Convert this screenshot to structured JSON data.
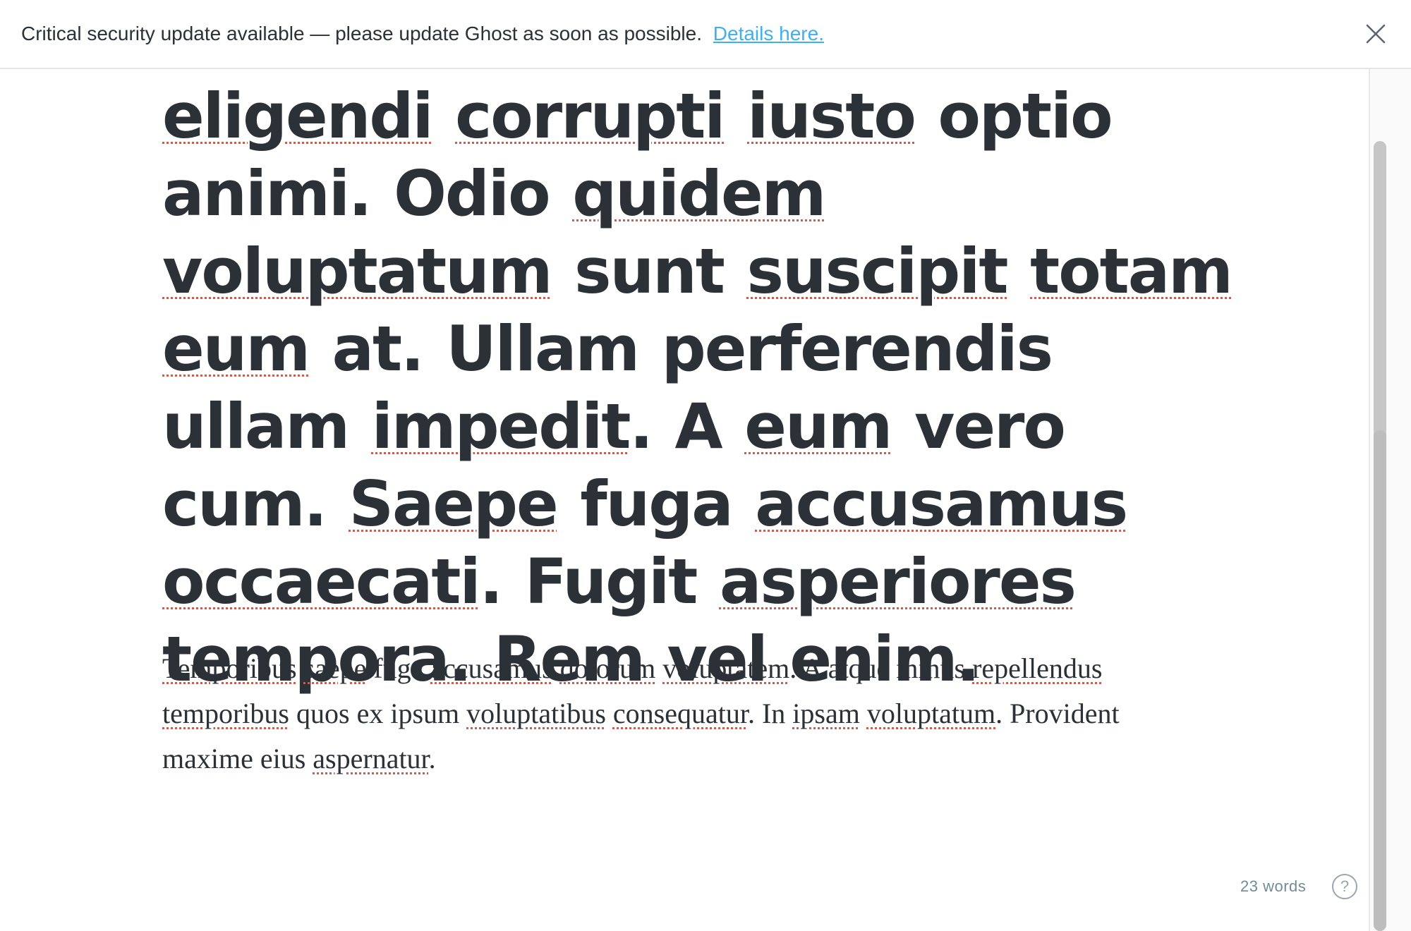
{
  "banner": {
    "message": "Critical security update available — please update Ghost as soon as possible.",
    "link_label": "Details here.",
    "close_icon": "close-icon"
  },
  "editor": {
    "title_words": [
      {
        "w": "eligendi",
        "s": true
      },
      {
        "w": "corrupti",
        "s": true
      },
      {
        "w": "iusto",
        "s": true
      },
      {
        "w": "optio",
        "s": false
      },
      {
        "w": "animi.",
        "s": false
      },
      {
        "w": "Odio",
        "s": false
      },
      {
        "w": "quidem",
        "s": true
      },
      {
        "w": "voluptatum",
        "s": true
      },
      {
        "w": "sunt",
        "s": false
      },
      {
        "w": "suscipit",
        "s": true
      },
      {
        "w": "totam",
        "s": true
      },
      {
        "w": "eum",
        "s": true
      },
      {
        "w": "at.",
        "s": false
      },
      {
        "w": "Ullam",
        "s": false
      },
      {
        "w": "perferendis",
        "s": false
      },
      {
        "w": "ullam",
        "s": false
      },
      {
        "w": "impedit",
        "s": true,
        "tail": "."
      },
      {
        "w": "A",
        "s": false
      },
      {
        "w": "eum",
        "s": true
      },
      {
        "w": "vero",
        "s": false
      },
      {
        "w": "cum.",
        "s": false
      },
      {
        "w": "Saepe",
        "s": true
      },
      {
        "w": "fuga",
        "s": false
      },
      {
        "w": "accusamus",
        "s": true
      },
      {
        "w": "occaecati",
        "s": true,
        "tail": "."
      },
      {
        "w": "Fugit",
        "s": false
      },
      {
        "w": "asperiores",
        "s": true
      },
      {
        "w": "tempora.",
        "s": false
      },
      {
        "w": "Rem",
        "s": false
      },
      {
        "w": "vel",
        "s": false
      },
      {
        "w": "enim.",
        "s": false
      }
    ],
    "body_words": [
      {
        "w": "Temporibus",
        "s": true
      },
      {
        "w": "saepe",
        "s": true
      },
      {
        "w": "fuga",
        "s": false
      },
      {
        "w": "accusamus",
        "s": true
      },
      {
        "w": "dolorum",
        "s": true
      },
      {
        "w": "voluptatem",
        "s": true,
        "tail": "."
      },
      {
        "w": "A",
        "s": false
      },
      {
        "w": "atque",
        "s": false
      },
      {
        "w": "minus",
        "s": false
      },
      {
        "w": "repellendus",
        "s": true
      },
      {
        "w": "temporibus",
        "s": true
      },
      {
        "w": "quos",
        "s": false
      },
      {
        "w": "ex",
        "s": false
      },
      {
        "w": "ipsum",
        "s": false
      },
      {
        "w": "voluptatibus",
        "s": true
      },
      {
        "w": "consequatur",
        "s": true,
        "tail": "."
      },
      {
        "w": "In",
        "s": false
      },
      {
        "w": "ipsam",
        "s": true
      },
      {
        "w": "voluptatum",
        "s": true,
        "tail": "."
      },
      {
        "w": "Provident",
        "s": false
      },
      {
        "w": "maxime",
        "s": false
      },
      {
        "w": "eius",
        "s": false
      },
      {
        "w": "aspernatur",
        "s": true,
        "tail": "."
      }
    ]
  },
  "status": {
    "word_count": "23 words",
    "help_label": "?",
    "help_icon": "help-icon"
  },
  "colors": {
    "text": "#2b3137",
    "link": "#3eb0ef",
    "spellcheck": "#e25440",
    "muted": "#738a94"
  }
}
